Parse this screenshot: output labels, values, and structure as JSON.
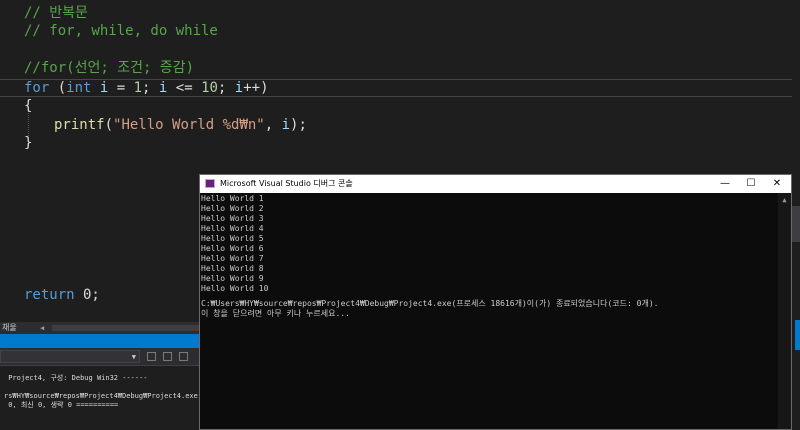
{
  "editor": {
    "comment1": "// 반복문",
    "comment2": "// for, while, do while",
    "comment3": "//for(선언; 조건; 증감)",
    "for_line": {
      "kw_for": "for",
      "paren_open": " (",
      "kw_int": "int",
      "var_i1": " i",
      "eq": " = ",
      "num1": "1",
      "semi1": "; ",
      "var_i2": "i",
      "cmp": " <= ",
      "num10": "10",
      "semi2": "; ",
      "var_i3": "i",
      "inc": "++)"
    },
    "brace_open": "{",
    "printf_line": {
      "fn": "printf",
      "paren": "(",
      "str": "\"Hello World %d₩n\"",
      "comma": ", ",
      "var_i": "i",
      "end": ");"
    },
    "brace_close": "}",
    "return_line": {
      "kw": "return",
      "rest": " 0;"
    }
  },
  "ide": {
    "zoom_label": "채울",
    "output_lines": [
      " Project4, 구성: Debug Win32 ------",
      "",
      "rs₩HY₩source₩repos₩Project4₩Debug₩Project4.exe",
      " 0, 최신 0, 생략 0 =========="
    ]
  },
  "console": {
    "title": "Microsoft Visual Studio 디버그 콘솔",
    "minimize": "—",
    "maximize": "☐",
    "close": "✕",
    "lines": [
      "Hello World 1",
      "Hello World 2",
      "Hello World 3",
      "Hello World 4",
      "Hello World 5",
      "Hello World 6",
      "Hello World 7",
      "Hello World 8",
      "Hello World 9",
      "Hello World 10",
      "",
      "C:₩Users₩HY₩source₩repos₩Project4₩Debug₩Project4.exe(프로세스 18616개)이(가) 종료되었습니다(코드: 0개).",
      "이 창을 닫으려면 아무 키나 누르세요..."
    ]
  },
  "colors": {
    "comment": "#57a64a",
    "keyword": "#569cd6",
    "string": "#d69d85",
    "accent_blue": "#007acc"
  }
}
